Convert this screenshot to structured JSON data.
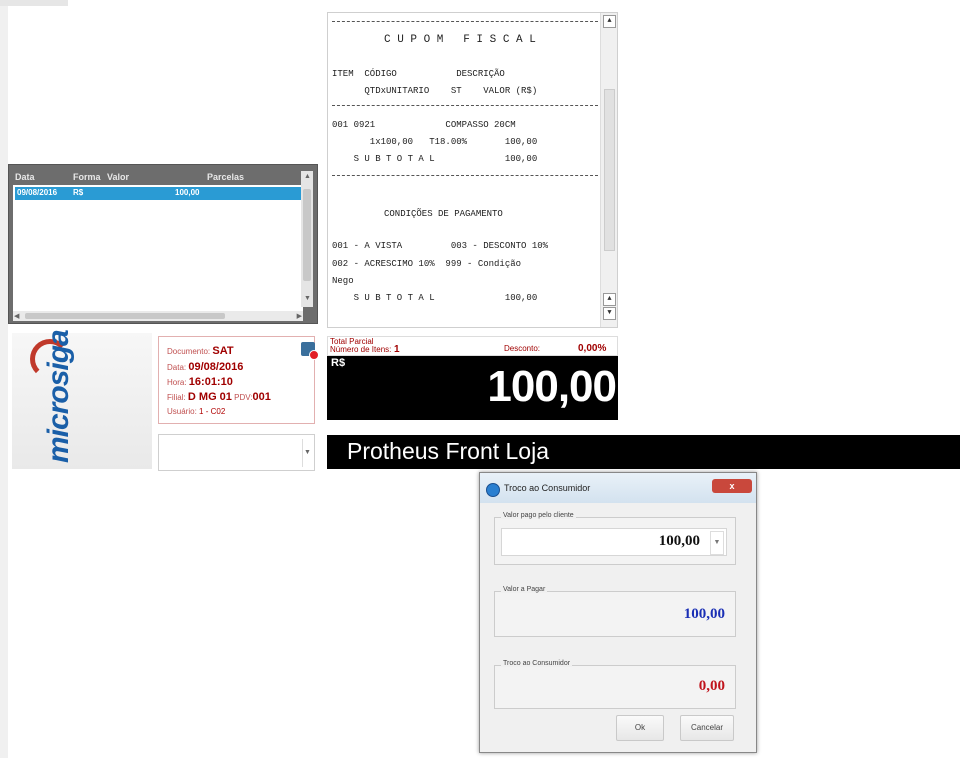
{
  "payments_grid": {
    "headers": [
      "Data",
      "Forma",
      "Valor",
      "Parcelas"
    ],
    "rows": [
      {
        "date": "09/08/2016",
        "form": "R$",
        "value": "100,00",
        "installments": ""
      }
    ]
  },
  "coupon": {
    "title": "C U P O M   F I S C A L",
    "col_header_1": "ITEM  CÓDIGO           DESCRIÇÃO",
    "col_header_2": "      QTDxUNITARIO    ST    VALOR (R$)",
    "item_line_1": "001 0921             COMPASSO 20CM",
    "item_line_2": "       1x100,00   T18.00%       100,00",
    "subtotal_1": "    S U B T O T A L             100,00",
    "payment_title": "CONDIÇÕES DE PAGAMENTO",
    "pay_line_1": "001 - A VISTA         003 - DESCONTO 10%",
    "pay_line_2": "002 - ACRESCIMO 10%  999 - Condição",
    "pay_line_3": "Nego",
    "subtotal_2": "    S U B T O T A L             100,00"
  },
  "logo_text": "microsiga",
  "document": {
    "documento_label": "Documento:",
    "documento_value": "SAT",
    "data_label": "Data:",
    "data_value": "09/08/2016",
    "hora_label": "Hora:",
    "hora_value": "16:01:10",
    "filial_label": "Filial:",
    "filial_value": "D MG 01",
    "pdv_label": "PDV:",
    "pdv_value": "001",
    "usuario_label": "Usuário:",
    "usuario_value": "1 - C02"
  },
  "totals": {
    "total_parcial_label": "Total Parcial",
    "num_itens_label": "Número de Itens:",
    "num_itens_value": "1",
    "desconto_label": "Desconto:",
    "desconto_value": "0,00%",
    "currency": "R$",
    "amount": "100,00"
  },
  "app_title": "Protheus Front Loja",
  "dialog": {
    "title": "Troco ao Consumidor",
    "close_label": "x",
    "pago_label": "Valor pago pelo cliente",
    "pago_value": "100,00",
    "pagar_label": "Valor a Pagar",
    "pagar_value": "100,00",
    "troco_label": "Troco ao Consumidor",
    "troco_value": "0,00",
    "ok_label": "Ok",
    "cancel_label": "Cancelar",
    "colors": {
      "pagar": "#1a2fb5",
      "troco": "#c0141c"
    }
  }
}
